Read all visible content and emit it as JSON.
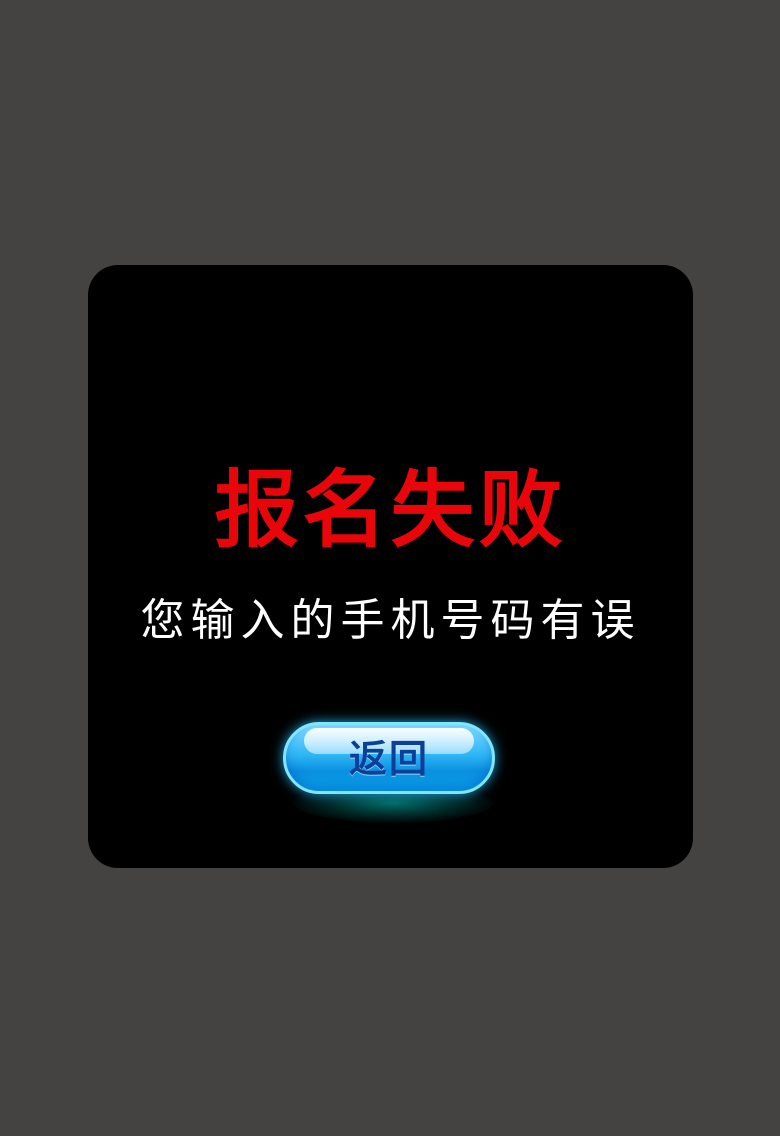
{
  "page": {
    "background_color": "#444342"
  },
  "dialog": {
    "background_color": "#000000",
    "title": "报名失败",
    "title_color": "#e8060a",
    "message": "您输入的手机号码有误",
    "message_color": "#ffffff",
    "back_button": {
      "label": "返回",
      "label_color": "#0b3f99",
      "button_color": "#1aa9f0"
    }
  }
}
